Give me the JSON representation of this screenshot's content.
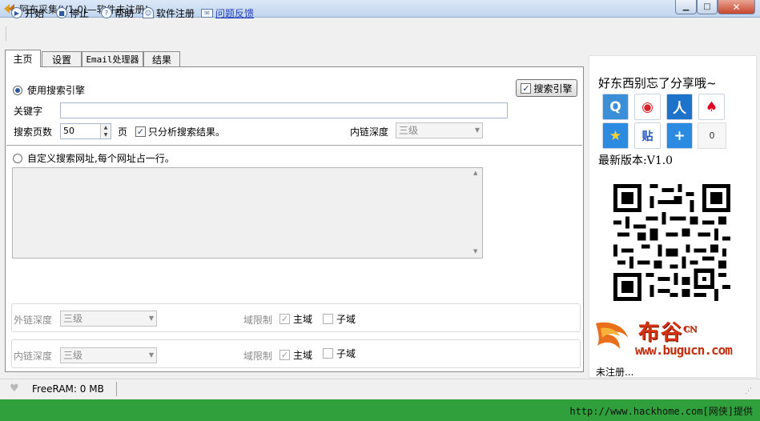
{
  "window": {
    "title": "阿布采集(V1.0)—软件未注册!"
  },
  "toolbar": {
    "start": "开始",
    "stop": "停止",
    "help": "帮助",
    "register": "软件注册",
    "feedback": "问题反馈"
  },
  "tabs": [
    "主页",
    "设置",
    "Email处理器",
    "结果"
  ],
  "search": {
    "use_engine_label": "使用搜索引擎",
    "engine_button": "搜索引擎",
    "keyword_label": "关键字",
    "keyword_value": "",
    "pages_label": "搜索页数",
    "pages_value": "50",
    "page_unit": "页",
    "only_results_label": "只分析搜索结果。",
    "inner_depth_label": "内链深度",
    "inner_depth_value": "三级"
  },
  "custom": {
    "label": "自定义搜索网址,每个网址占一行。",
    "urls": ""
  },
  "outer_group": {
    "depth_label": "外链深度",
    "depth_value": "三级",
    "domain_label": "域限制",
    "main_label": "主域",
    "sub_label": "子域"
  },
  "inner_group": {
    "depth_label": "内链深度",
    "depth_value": "三级",
    "domain_label": "域限制",
    "main_label": "主域",
    "sub_label": "子域"
  },
  "share": {
    "title": "好东西别忘了分享哦~",
    "count": "0",
    "icons": [
      "qzone-icon",
      "weibo-icon",
      "renren-icon",
      "tencent-weibo-icon",
      "favorite-icon",
      "tieba-icon",
      "more-icon"
    ]
  },
  "version": "最新版本:V1.0",
  "logo": {
    "name": "布谷",
    "sup": "CN",
    "url": "www.bugucn.com"
  },
  "unregistered": "未注册...",
  "status": {
    "freeram_label": "FreeRAM:",
    "freeram_value": "0",
    "freeram_unit": "MB"
  },
  "watermark": "http://www.hackhome.com[网侠]提供",
  "colors": {
    "green_bar": "#2fa03b",
    "link": "#2440c0",
    "accent": "#2b5aa0"
  }
}
